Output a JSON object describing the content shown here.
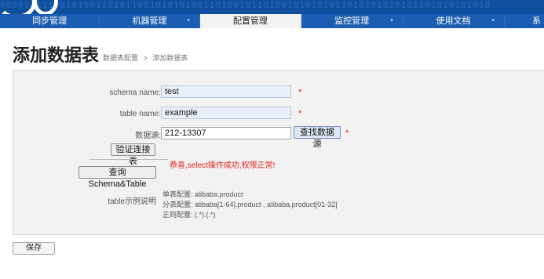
{
  "nav": {
    "items": [
      {
        "label": "同步管理"
      },
      {
        "label": "机器管理"
      },
      {
        "label": "配置管理"
      },
      {
        "label": "监控管理"
      },
      {
        "label": "使用文档"
      },
      {
        "label": "系"
      }
    ],
    "active_index": 2
  },
  "header": {
    "title": "添加数据表",
    "breadcrumb": [
      "数据表配置",
      ">",
      "添加数据表"
    ]
  },
  "form": {
    "schema_label": "schema name:",
    "schema_value": "test",
    "table_label": "table name:",
    "table_value": "example",
    "source_label": "数据源:",
    "source_value": "212-13307",
    "find_source_button": "查找数据源",
    "required_mark": "*",
    "verify_button": "验证连接表",
    "query_button": "查询Schema&Table",
    "success_message": "恭喜,select操作成功,权限正常!",
    "example_label": "table示例说明",
    "example_lines": [
      "单表配置: alibaba.product",
      "分表配置: alibaba[1-64].product , alibaba.product[01-32]",
      "正则配置: (.*).(.*)"
    ]
  },
  "footer": {
    "save_button": "保存"
  },
  "colors": {
    "nav_bg": "#1b5db3",
    "banner_bg": "#0e4f9e",
    "active_tab_bg": "#f3f3f3",
    "required": "#e02020",
    "success": "#e02020",
    "input_bg": "#e9f0fb"
  }
}
